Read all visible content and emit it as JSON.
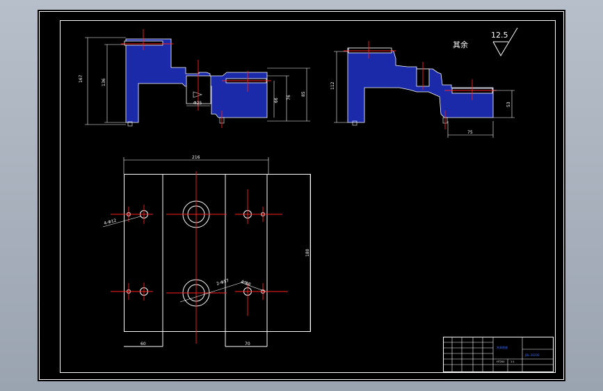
{
  "roughness": {
    "value": "12.5",
    "note": "其余"
  },
  "dimensions": {
    "front_total_height": "167",
    "front_inner_height": "136",
    "front_diameter": "Φ25",
    "front_right_h1": "66",
    "front_right_h2": "76",
    "front_right_h3": "85",
    "side_height": "112",
    "side_right_height": "53",
    "side_bottom_width": "75",
    "top_width": "216",
    "top_height": "180",
    "bottom_left": "60",
    "bottom_right": "70",
    "holes_a": "4-Φ12",
    "holes_b": "2-Φ57",
    "holes_c": "4-Φ8"
  },
  "title_block": {
    "part_name": "夹具底座",
    "drawing_no": "JDL-20200",
    "material": "HT200",
    "scale": "1:1"
  }
}
